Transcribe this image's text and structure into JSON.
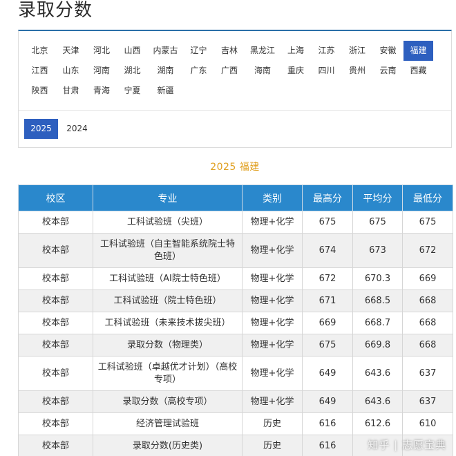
{
  "page": {
    "title": "录取分数"
  },
  "provinces": [
    [
      "北京",
      "天津",
      "河北",
      "山西",
      "内蒙古",
      "辽宁",
      "吉林",
      "黑龙江",
      "上海",
      "江苏",
      "浙江",
      "安徽",
      "福建"
    ],
    [
      "江西",
      "山东",
      "河南",
      "湖北",
      "湖南",
      "广东",
      "广西",
      "海南",
      "重庆",
      "四川",
      "贵州",
      "云南",
      "西藏"
    ],
    [
      "陕西",
      "甘肃",
      "青海",
      "宁夏",
      "新疆"
    ]
  ],
  "selected_province": "福建",
  "years": [
    "2025",
    "2024"
  ],
  "selected_year": "2025",
  "section": {
    "title": "2025 福建"
  },
  "table": {
    "headers": [
      "校区",
      "专业",
      "类别",
      "最高分",
      "平均分",
      "最低分"
    ],
    "rows": [
      [
        "校本部",
        "工科试验班（尖班）",
        "物理+化学",
        "675",
        "675",
        "675"
      ],
      [
        "校本部",
        "工科试验班（自主智能系统院士特色班）",
        "物理+化学",
        "674",
        "673",
        "672"
      ],
      [
        "校本部",
        "工科试验班（AI院士特色班）",
        "物理+化学",
        "672",
        "670.3",
        "669"
      ],
      [
        "校本部",
        "工科试验班（院士特色班）",
        "物理+化学",
        "671",
        "668.5",
        "668"
      ],
      [
        "校本部",
        "工科试验班（未来技术拔尖班）",
        "物理+化学",
        "669",
        "668.7",
        "668"
      ],
      [
        "校本部",
        "录取分数（物理类）",
        "物理+化学",
        "675",
        "669.8",
        "668"
      ],
      [
        "校本部",
        "工科试验班（卓越优才计划）（高校专项）",
        "物理+化学",
        "649",
        "643.6",
        "637"
      ],
      [
        "校本部",
        "录取分数（高校专项）",
        "物理+化学",
        "649",
        "643.6",
        "637"
      ],
      [
        "校本部",
        "经济管理试验班",
        "历史",
        "616",
        "612.6",
        "610"
      ],
      [
        "校本部",
        "录取分数(历史类)",
        "历史",
        "616",
        "",
        ""
      ]
    ]
  },
  "watermark": {
    "text": "知乎 | 志愿宝典"
  },
  "colors": {
    "accent": "#2d5fbf",
    "header": "#2a88cc",
    "section_title": "#e0a020"
  }
}
